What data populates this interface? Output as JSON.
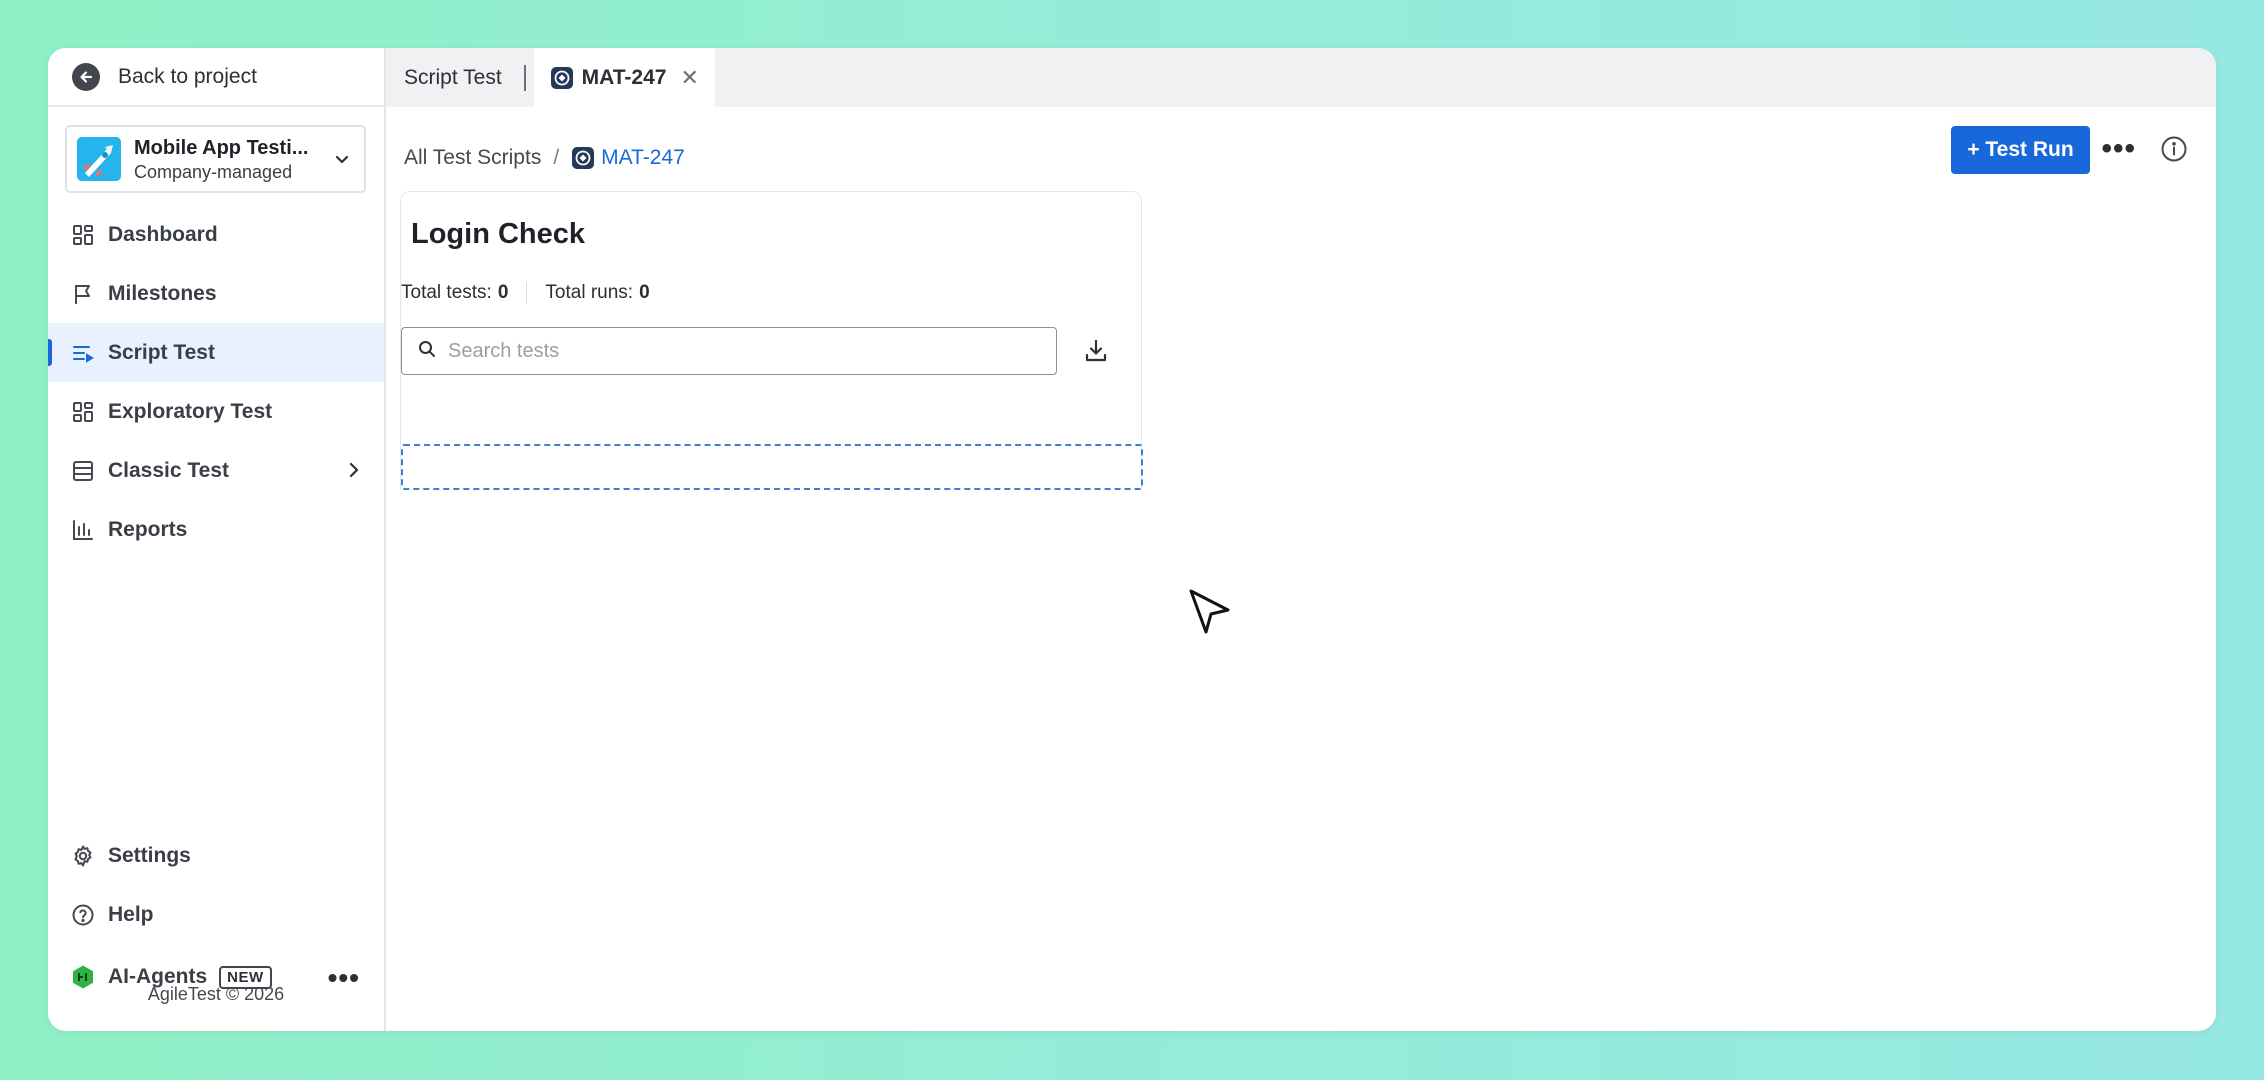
{
  "sidebar": {
    "back_label": "Back to project",
    "project": {
      "name": "Mobile App Testi...",
      "subtitle": "Company-managed"
    },
    "items": [
      {
        "label": "Dashboard",
        "icon": "grid-icon"
      },
      {
        "label": "Milestones",
        "icon": "flag-icon"
      },
      {
        "label": "Script Test",
        "icon": "script-list-icon",
        "active": true
      },
      {
        "label": "Exploratory Test",
        "icon": "grid-icon"
      },
      {
        "label": "Classic Test",
        "icon": "table-icon",
        "has_children": true
      },
      {
        "label": "Reports",
        "icon": "bar-chart-icon"
      }
    ],
    "bottom_items": [
      {
        "label": "Settings",
        "icon": "gear-icon"
      },
      {
        "label": "Help",
        "icon": "help-circle-icon"
      }
    ],
    "agents": {
      "label": "AI-Agents",
      "badge": "NEW",
      "more": "•••"
    },
    "footer": "AgileTest © 2026"
  },
  "tabs": [
    {
      "label": "Script Test"
    },
    {
      "label": "MAT-247",
      "active": true,
      "close": "✕"
    }
  ],
  "breadcrumb": {
    "root": "All Test Scripts",
    "separator": "/",
    "current": "MAT-247"
  },
  "toolbar": {
    "run_button": "+ Test Run",
    "more": "•••"
  },
  "panel": {
    "title": "Login Check",
    "stats": {
      "tests_label": "Total tests:",
      "tests_value": "0",
      "runs_label": "Total runs:",
      "runs_value": "0"
    },
    "search": {
      "placeholder": "Search tests",
      "value": ""
    }
  },
  "colors": {
    "accent": "#1868db",
    "active_nav_bg": "#e9f1fe",
    "background": "#95ecd9"
  }
}
